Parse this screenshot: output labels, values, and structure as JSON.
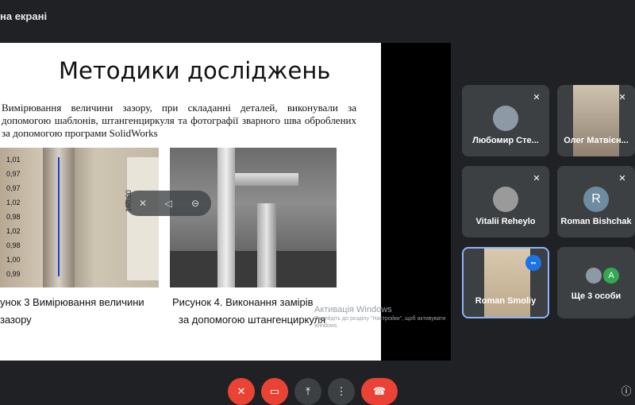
{
  "header": {
    "presenting_label": "на екрані"
  },
  "slide": {
    "title": "Методики досліджень",
    "body": "Вимірювання величини  зазору,  при складанні деталей, виконували за допомогою шаблонів, штангенциркуля та фотографії зварного шва оброблених за допомогою програми  SolidWorks",
    "figure1": {
      "measurements": [
        "1,01",
        "0,97",
        "0,97",
        "1,02",
        "0,98",
        "1,02",
        "0,98",
        "1,00",
        "0,99"
      ],
      "ruler_label": "160,00",
      "caption_line1": "унок 3  Вимірювання величини",
      "caption_line2": "зазору"
    },
    "figure2": {
      "caption_line1": "Рисунок 4. Виконання замірів",
      "caption_line2": "за допомогою штангенциркуля"
    }
  },
  "watermark": {
    "title": "Активація Windows",
    "subtitle": "Перейдіть до розділу \"Настройки\", щоб активувати Windows."
  },
  "participants": [
    {
      "name": "Любомир Сте...",
      "avatar": "photo",
      "muted": true
    },
    {
      "name": "Олег Матвієн...",
      "avatar": "video",
      "muted": true
    },
    {
      "name": "Vitalii Reheylo",
      "avatar": "photo",
      "muted": true
    },
    {
      "name": "Roman Bishchak",
      "avatar_letter": "R",
      "muted": true
    },
    {
      "name": "Roman Smoliy",
      "avatar": "video",
      "speaking": true
    },
    {
      "name": "Ще 3 особи",
      "avatar_letter": "A"
    }
  ],
  "colors": {
    "end_call": "#ea4335",
    "speaking": "#1a73e8",
    "tile_bg": "#3c4043"
  }
}
